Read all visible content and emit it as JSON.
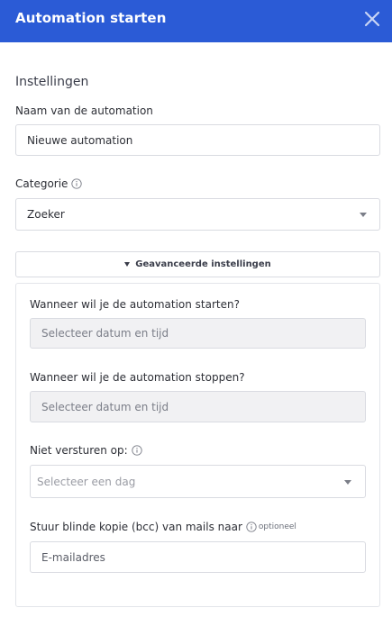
{
  "header": {
    "title": "Automation starten",
    "close_icon": "close-icon"
  },
  "settings": {
    "heading": "Instellingen",
    "name_label": "Naam van de automation",
    "name_value": "Nieuwe automation",
    "category_label": "Categorie",
    "category_value": "Zoeker"
  },
  "advanced": {
    "toggle_label": "Geavanceerde instellingen",
    "start_label": "Wanneer wil je de automation starten?",
    "start_placeholder": "Selecteer datum en tijd",
    "stop_label": "Wanneer wil je de automation stoppen?",
    "stop_placeholder": "Selecteer datum en tijd",
    "no_send_label": "Niet versturen op:",
    "no_send_placeholder": "Selecteer een dag",
    "bcc_label": "Stuur blinde kopie (bcc) van mails naar",
    "bcc_optional": "optioneel",
    "bcc_placeholder": "E-mailadres"
  },
  "colors": {
    "header_bg": "#2b5bd6",
    "disabled_bg": "#f1f1f3",
    "border": "#d9dbe1"
  }
}
